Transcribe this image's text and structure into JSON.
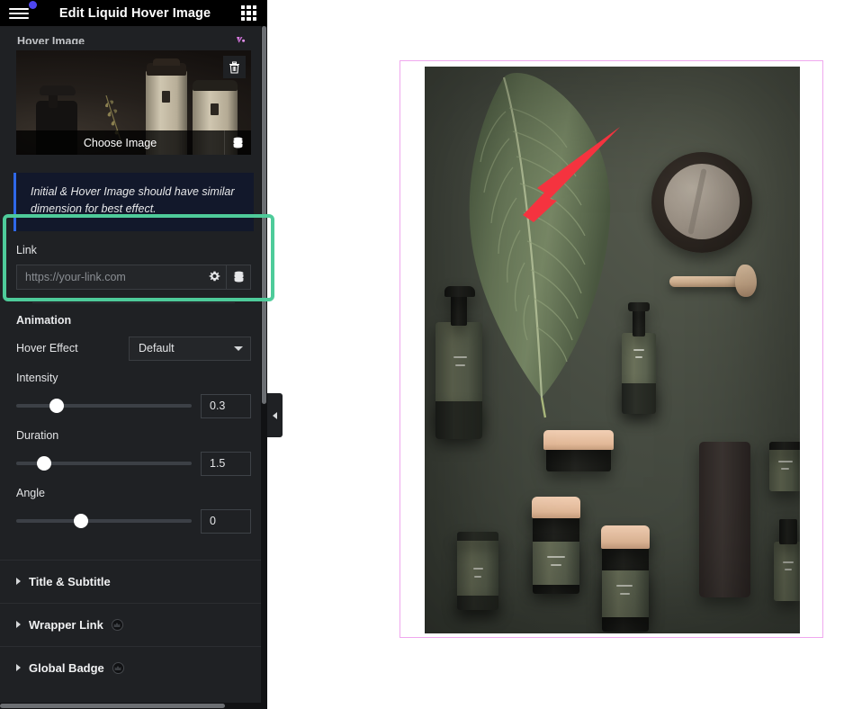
{
  "panel": {
    "header": {
      "title": "Edit Liquid Hover Image",
      "menu_icon": "hamburger-menu-icon",
      "apps_icon": "grid-apps-icon",
      "notification_dot": true
    },
    "section_label": "Hover Image",
    "ai_icon": "ai-sparkle-icon",
    "media": {
      "choose_label": "Choose Image",
      "delete_icon": "trash-icon",
      "dynamic_icon": "database-dynamic-tags-icon"
    },
    "notice": {
      "text": "Initial & Hover Image should have similar dimension for best effect.",
      "accent_color": "#2f68e8",
      "background": "#12182b"
    },
    "link": {
      "label": "Link",
      "value": "",
      "placeholder": "https://your-link.com",
      "options_icon": "gear-icon",
      "dynamic_icon": "database-dynamic-tags-icon"
    },
    "highlight": {
      "color": "#4ecb9a"
    },
    "animation": {
      "title": "Animation",
      "hover_effect": {
        "label": "Hover Effect",
        "value": "Default",
        "options": [
          "Default"
        ]
      },
      "sliders": [
        {
          "label": "Intensity",
          "value": "0.3",
          "percent": 23
        },
        {
          "label": "Duration",
          "value": "1.5",
          "percent": 16
        },
        {
          "label": "Angle",
          "value": "0",
          "percent": 37
        }
      ]
    },
    "accordions": [
      {
        "label": "Title & Subtitle",
        "pro": false
      },
      {
        "label": "Wrapper Link",
        "pro": true
      },
      {
        "label": "Global Badge",
        "pro": true
      }
    ],
    "collapse_handle_icon": "chevron-left-icon"
  },
  "canvas": {
    "widget_border_color": "#f0a8ee",
    "image_alt": "Olive green cosmetic product flat lay with tropical leaf, stone dish and wooden spatula"
  },
  "annotation": {
    "arrow_color": "#f5333f",
    "arrow_icon": "red-pointer-arrow"
  }
}
